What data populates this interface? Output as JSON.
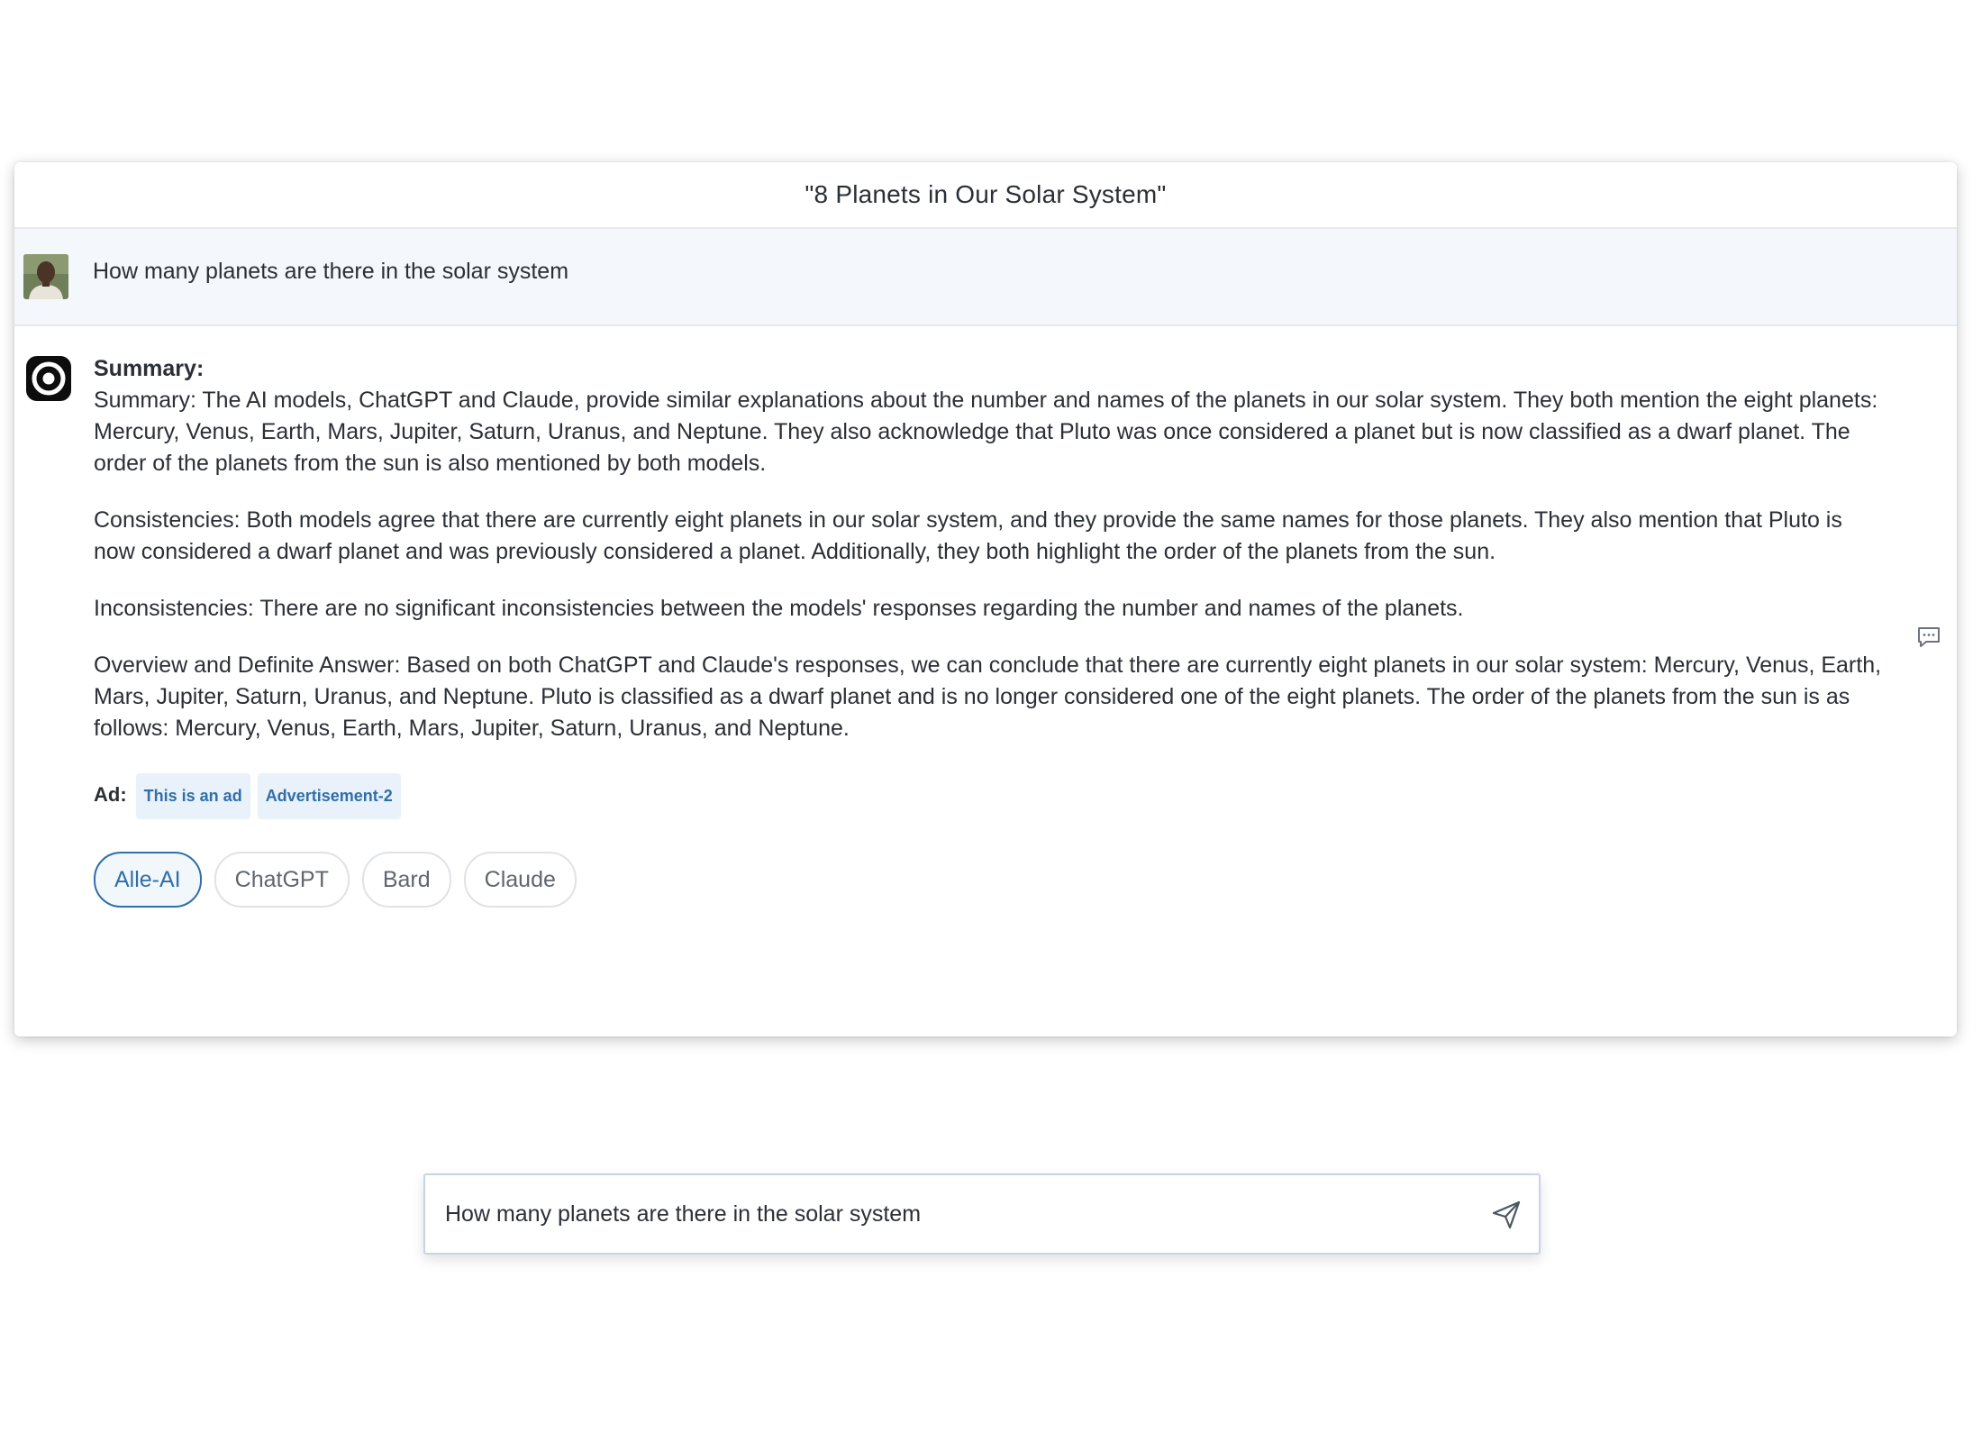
{
  "header": {
    "title": "\"8 Planets in Our Solar System\""
  },
  "user_message": {
    "text": "How many planets are there in the solar system"
  },
  "answer": {
    "heading": "Summary:",
    "paragraphs": [
      "Summary: The AI models, ChatGPT and Claude, provide similar explanations about the number and names of the planets in our solar system. They both mention the eight planets: Mercury, Venus, Earth, Mars, Jupiter, Saturn, Uranus, and Neptune. They also acknowledge that Pluto was once considered a planet but is now classified as a dwarf planet. The order of the planets from the sun is also mentioned by both models.",
      "Consistencies: Both models agree that there are currently eight planets in our solar system, and they provide the same names for those planets. They also mention that Pluto is now considered a dwarf planet and was previously considered a planet. Additionally, they both highlight the order of the planets from the sun.",
      "Inconsistencies: There are no significant inconsistencies between the models' responses regarding the number and names of the planets.",
      "Overview and Definite Answer: Based on both ChatGPT and Claude's responses, we can conclude that there are currently eight planets in our solar system: Mercury, Venus, Earth, Mars, Jupiter, Saturn, Uranus, and Neptune. Pluto is classified as a dwarf planet and is no longer considered one of the eight planets. The order of the planets from the sun is as follows: Mercury, Venus, Earth, Mars, Jupiter, Saturn, Uranus, and Neptune."
    ]
  },
  "ads": {
    "label": "Ad:",
    "chips": [
      "This is an ad",
      "Advertisement-2"
    ]
  },
  "model_tabs": {
    "items": [
      "Alle-AI",
      "ChatGPT",
      "Bard",
      "Claude"
    ],
    "active": "Alle-AI"
  },
  "input": {
    "value": "How many planets are there in the solar system",
    "placeholder": ""
  },
  "icons": {
    "user": "user-avatar",
    "bot": "bot-logo-icon",
    "comment": "comment-icon",
    "send": "send-icon"
  },
  "colors": {
    "accent": "#2f6fa8",
    "user_row_bg": "#f4f7fb",
    "ad_chip_bg": "#e9f1fa"
  }
}
